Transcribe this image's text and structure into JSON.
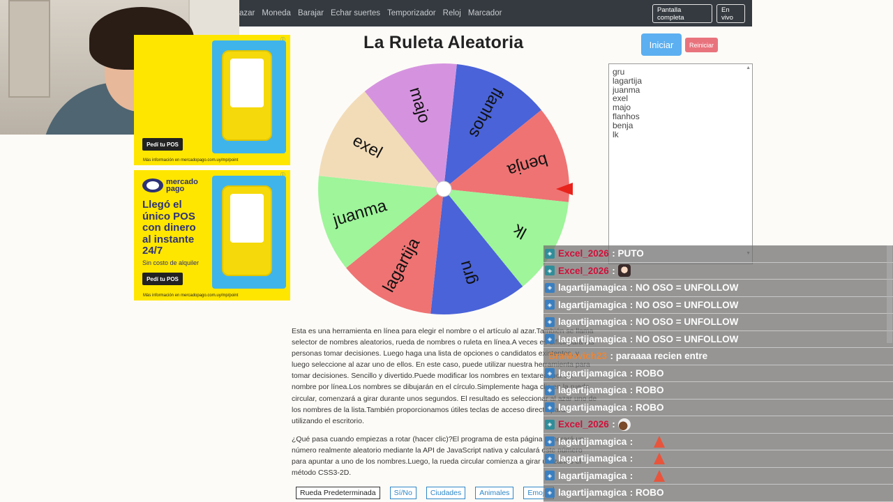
{
  "nav": {
    "links": [
      "azar",
      "Moneda",
      "Barajar",
      "Echar suertes",
      "Temporizador",
      "Reloj",
      "Marcador"
    ],
    "fullscreen_label": "Pantalla completa",
    "live_label": "En vivo"
  },
  "ads": [
    {
      "button_label": "Pedí tu POS",
      "more_info": "Más información en mercadopago.com.uy/mp/point"
    },
    {
      "brand": "mercado pago",
      "headline": "Llegó el único POS con dinero al instante 24/7",
      "subline": "Sin costo de alquiler",
      "button_label": "Pedí tu POS",
      "more_info": "Más información en mercadopago.com.uy/mp/point"
    }
  ],
  "main": {
    "title": "La Ruleta Aleatoria",
    "start_label": "Iniciar",
    "reset_label": "Reiniciar"
  },
  "wheel": {
    "segments": [
      {
        "label": "flanhos",
        "color": "#4a63d8"
      },
      {
        "label": "benja",
        "color": "#ef7373"
      },
      {
        "label": "lk",
        "color": "#9ef59a"
      },
      {
        "label": "gru",
        "color": "#4a63d8"
      },
      {
        "label": "lagartija",
        "color": "#ef7373"
      },
      {
        "label": "juanma",
        "color": "#9ef59a"
      },
      {
        "label": "exel",
        "color": "#f2dcb8"
      },
      {
        "label": "majo",
        "color": "#d593df"
      }
    ],
    "pointer_color": "#e8231c"
  },
  "names_list": [
    "gru",
    "lagartija",
    "juanma",
    "exel",
    "majo",
    "flanhos",
    "benja",
    "lk"
  ],
  "description": [
    "Esta es una herramienta en línea para elegir el nombre o el artículo al azar.También se llama selector de nombres aleatorios, rueda de nombres o ruleta en línea.A veces es difícil para las personas tomar decisiones. Luego haga una lista de opciones o candidatos existentes, y luego seleccione al azar uno de ellos. En este caso, puede utilizar nuestra herramienta para tomar decisiones. Sencillo y divertido.Puede modificar los nombres en textarea, por un nombre por línea.Los nombres se dibujarán en el círculo.Simplemente haga clic en la rueda circular, comenzará a girar durante unos segundos. El resultado es seleccionar al azar uno de los nombres de la lista.También proporcionamos útiles teclas de acceso directo para utilizando el escritorio.",
    "¿Qué pasa cuando empiezas a rotar (hacer clic)?El programa de esta página generará un número realmente aleatorio mediante la API de JavaScript nativa y calculará este número para apuntar a uno de los nombres.Luego, la rueda circular comienza a girar utilizando el método CSS3-2D."
  ],
  "bottom_buttons": [
    "Rueda Predeterminada",
    "Sí/No",
    "Ciudades",
    "Animales",
    "Emojis"
  ],
  "chat": [
    {
      "user": "Excel_2026",
      "user_color": "#d0103a",
      "msg": ": PUTO",
      "badge": "teal",
      "emote": ""
    },
    {
      "user": "Excel_2026",
      "user_color": "#d0103a",
      "msg": ":",
      "badge": "teal",
      "emote": "girl"
    },
    {
      "user": "lagartijamagica",
      "user_color": "#ffffff",
      "msg": ": NO OSO = UNFOLLOW",
      "badge": "blue",
      "emote": ""
    },
    {
      "user": "lagartijamagica",
      "user_color": "#ffffff",
      "msg": ": NO OSO = UNFOLLOW",
      "badge": "blue",
      "emote": ""
    },
    {
      "user": "lagartijamagica",
      "user_color": "#ffffff",
      "msg": ": NO OSO = UNFOLLOW",
      "badge": "blue",
      "emote": ""
    },
    {
      "user": "lagartijamagica",
      "user_color": "#ffffff",
      "msg": ": NO OSO = UNFOLLOW",
      "badge": "blue",
      "emote": ""
    },
    {
      "user": "BraMovich23",
      "user_color": "#e8873a",
      "msg": ": paraaaa recien entre",
      "badge": "",
      "emote": ""
    },
    {
      "user": "lagartijamagica",
      "user_color": "#ffffff",
      "msg": ": ROBO",
      "badge": "blue",
      "emote": ""
    },
    {
      "user": "lagartijamagica",
      "user_color": "#ffffff",
      "msg": ": ROBO",
      "badge": "blue",
      "emote": ""
    },
    {
      "user": "lagartijamagica",
      "user_color": "#ffffff",
      "msg": ": ROBO",
      "badge": "blue",
      "emote": ""
    },
    {
      "user": "Excel_2026",
      "user_color": "#d0103a",
      "msg": ":",
      "badge": "teal",
      "emote": "coffee"
    },
    {
      "user": "lagartijamagica",
      "user_color": "#ffffff",
      "msg": ":",
      "badge": "blue",
      "emote": "cone"
    },
    {
      "user": "lagartijamagica",
      "user_color": "#ffffff",
      "msg": ":",
      "badge": "blue",
      "emote": "cone"
    },
    {
      "user": "lagartijamagica",
      "user_color": "#ffffff",
      "msg": ":",
      "badge": "blue",
      "emote": "cone"
    },
    {
      "user": "lagartijamagica",
      "user_color": "#ffffff",
      "msg": ": ROBO",
      "badge": "blue",
      "emote": ""
    }
  ]
}
